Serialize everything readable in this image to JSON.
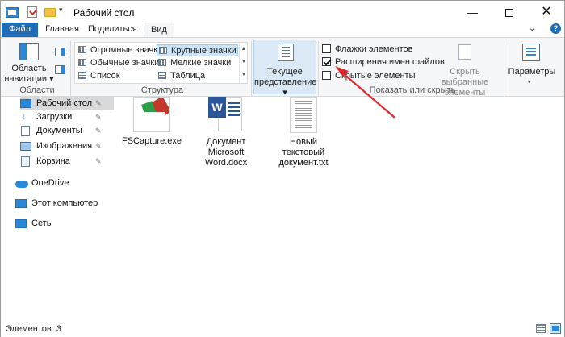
{
  "window": {
    "title": "Рабочий стол",
    "minimize": "—",
    "close": "✕"
  },
  "ribbon_tabs": {
    "file": "Файл",
    "home": "Главная",
    "share": "Поделиться",
    "view": "Вид",
    "expand": "⌄",
    "help": "?"
  },
  "ribbon": {
    "areas": {
      "nav_pane_line1": "Область",
      "nav_pane_line2": "навигации ▾",
      "group_label": "Области"
    },
    "layout": {
      "items": [
        "Огромные значки",
        "Обычные значки",
        "Список",
        "Крупные значки",
        "Мелкие значки",
        "Таблица"
      ],
      "selected": "Крупные значки",
      "group_label": "Структура"
    },
    "current_view": {
      "line1": "Текущее",
      "line2": "представление ▾"
    },
    "show_hide": {
      "checkboxes": [
        {
          "label": "Флажки элементов",
          "checked": false
        },
        {
          "label": "Расширения имен файлов",
          "checked": true
        },
        {
          "label": "Скрытые элементы",
          "checked": false
        }
      ],
      "hide_selected_line1": "Скрыть выбранные",
      "hide_selected_line2": "элементы",
      "group_label": "Показать или скрыть"
    },
    "options": {
      "label": "Параметры",
      "caret": "▾"
    }
  },
  "nav_pane": {
    "items": [
      {
        "label": "Рабочий стол",
        "icon": "desktop-icon",
        "pinned": true
      },
      {
        "label": "Загрузки",
        "icon": "downloads-icon",
        "pinned": true
      },
      {
        "label": "Документы",
        "icon": "documents-icon",
        "pinned": true
      },
      {
        "label": "Изображения",
        "icon": "pictures-icon",
        "pinned": true
      },
      {
        "label": "Корзина",
        "icon": "recycle-bin-icon",
        "pinned": true
      },
      {
        "label": "OneDrive",
        "icon": "onedrive-icon",
        "pinned": false
      },
      {
        "label": "Этот компьютер",
        "icon": "this-pc-icon",
        "pinned": false
      },
      {
        "label": "Сеть",
        "icon": "network-icon",
        "pinned": false
      }
    ],
    "pin_glyph": "📌"
  },
  "files": [
    {
      "name": "FSCapture.exe",
      "icon": "fscapture-app-icon"
    },
    {
      "name": "Документ\nMicrosoft\nWord.docx",
      "icon": "word-document-icon"
    },
    {
      "name": "Новый\nтекстовый\nдокумент.txt",
      "icon": "text-document-icon"
    }
  ],
  "status_bar": {
    "item_count": "Элементов: 3"
  },
  "colors": {
    "accent": "#1e6bb8",
    "selection": "#cce4f7",
    "annotation_arrow": "#e0282f"
  }
}
